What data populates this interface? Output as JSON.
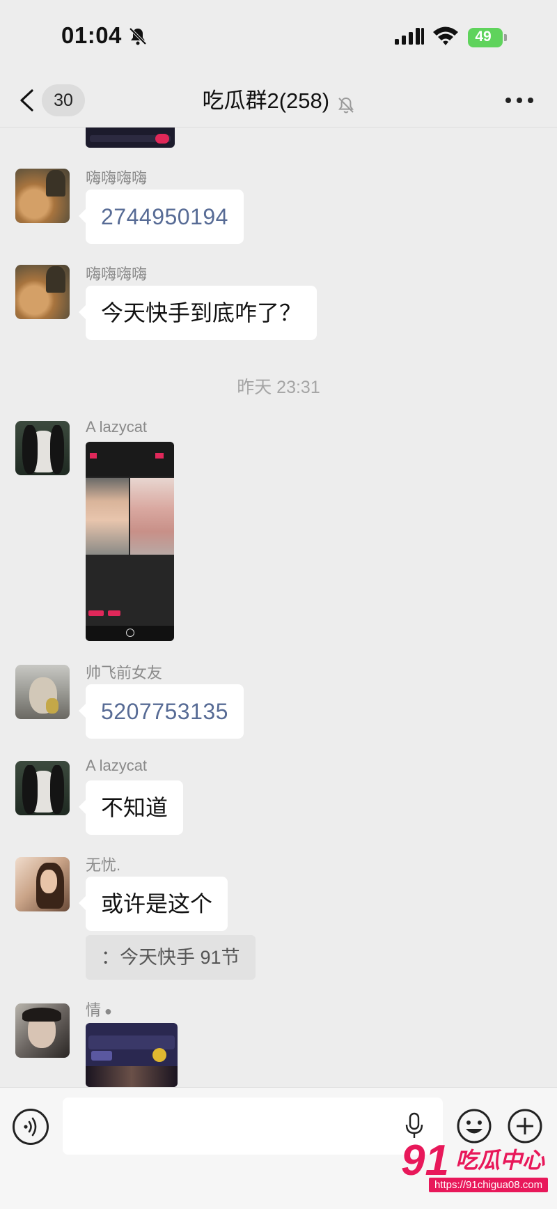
{
  "status_bar": {
    "time": "01:04",
    "battery": "49"
  },
  "header": {
    "back_count": "30",
    "title": "吃瓜群2(258)"
  },
  "messages": [
    {
      "sender": "嗨嗨嗨嗨",
      "text": "2744950194"
    },
    {
      "sender": "嗨嗨嗨嗨",
      "text": "今天快手到底咋了？"
    },
    {
      "sender": "A lazycat"
    },
    {
      "sender": "帅飞前女友",
      "text": "5207753135"
    },
    {
      "sender": "A lazycat",
      "text": "不知道"
    },
    {
      "sender": "无忧.",
      "text": "或许是这个",
      "quote": "：今天快手 91节"
    },
    {
      "sender": "情"
    }
  ],
  "timestamp": "昨天 23:31",
  "input": {
    "placeholder": ""
  },
  "watermark": {
    "num": "91",
    "name": "吃瓜中心",
    "url": "https://91chigua08.com"
  },
  "icons": [
    "back-icon",
    "bell-off-icon",
    "signal-icon",
    "wifi-icon",
    "more-icon",
    "voice-icon",
    "mic-icon",
    "emoji-icon",
    "plus-icon"
  ]
}
